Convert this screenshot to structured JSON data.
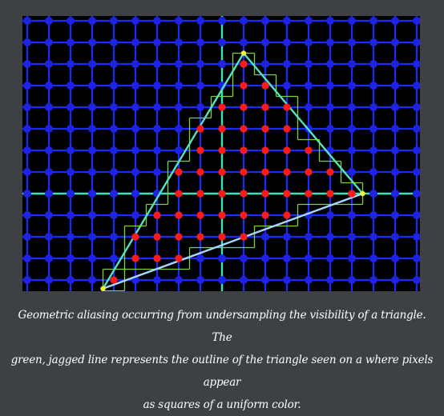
{
  "figure": {
    "grid": {
      "columns": 19,
      "rows": 13,
      "line_color": "#1a2bff",
      "dot_color": "#1e22e6"
    },
    "axes": {
      "color": "#3fe0b0",
      "origin_column": 9,
      "origin_row": 8
    },
    "triangle": {
      "vertices": [
        [
          10,
          1.5
        ],
        [
          15.5,
          8
        ],
        [
          3.5,
          12.4
        ]
      ],
      "edge_color": "#55e3c0",
      "bottom_edge_color": "#a8d8ff",
      "vertex_color": "#f4f23a"
    },
    "covered_pixel_color": "#ff1a1a",
    "jagged_outline_color": "#7fd23a"
  },
  "caption": {
    "line1": "Geometric aliasing occurring from undersampling the visibility of a triangle. The",
    "line2": "green, jagged line represents the outline of the triangle seen on a where pixels appear",
    "line3": "as squares of a uniform color."
  }
}
